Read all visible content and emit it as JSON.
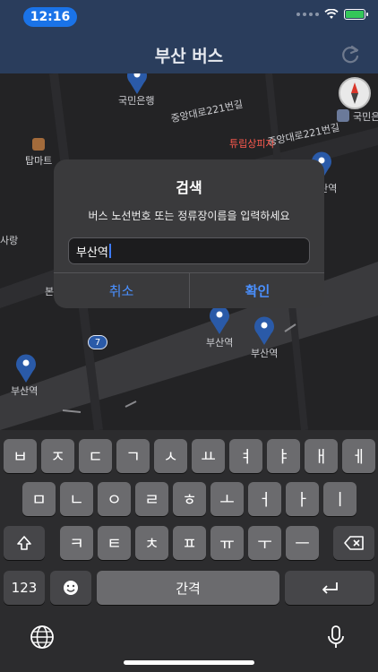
{
  "status_bar": {
    "time": "12:16"
  },
  "header": {
    "title": "부산 버스",
    "refresh_icon": "refresh-icon"
  },
  "map": {
    "labels": {
      "bank": "국민은행",
      "street1": "중앙대로221번길",
      "street2": "중앙대로221번길",
      "bank2": "국민은",
      "pizza": "튜립상피자",
      "mart": "탑마트",
      "place_left": "사랑",
      "place_left2": "본",
      "stop_a": "부산역",
      "stop_b": "부산역",
      "stop_c": "부산역",
      "stop_d": "부산역"
    },
    "route_badge": "7",
    "compass_letter": "북"
  },
  "dialog": {
    "title": "검색",
    "message": "버스 노선번호 또는 정류장이름을 입력하세요",
    "input_value": "부산역",
    "cancel_label": "취소",
    "ok_label": "확인"
  },
  "keyboard": {
    "row1": [
      "ㅂ",
      "ㅈ",
      "ㄷ",
      "ㄱ",
      "ㅅ",
      "ㅛ",
      "ㅕ",
      "ㅑ",
      "ㅐ",
      "ㅔ"
    ],
    "row2": [
      "ㅁ",
      "ㄴ",
      "ㅇ",
      "ㄹ",
      "ㅎ",
      "ㅗ",
      "ㅓ",
      "ㅏ",
      "ㅣ"
    ],
    "row3": [
      "ㅋ",
      "ㅌ",
      "ㅊ",
      "ㅍ",
      "ㅠ",
      "ㅜ",
      "ㅡ"
    ],
    "numbers_label": "123",
    "space_label": "간격"
  },
  "colors": {
    "header_bg": "#2a3d5c",
    "accent_blue": "#4a90ff",
    "time_pill": "#1a73e8"
  }
}
